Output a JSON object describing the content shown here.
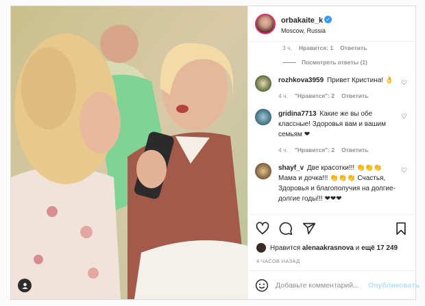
{
  "header": {
    "username": "orbakaite_k",
    "location": "Moscow, Russia"
  },
  "top_meta": {
    "time": "3 ч.",
    "likes": "Нравится: 1",
    "reply": "Ответить"
  },
  "view_replies": "Посмотреть ответы (1)",
  "comments": [
    {
      "user": "rozhkova3959",
      "text": "Привет Кристина! 👌",
      "time": "4 ч.",
      "likes": "\"Нравится\": 2",
      "reply": "Ответить"
    },
    {
      "user": "gridina7713",
      "text": "Какие же вы обе классные! Здоровья вам и вашим семьям ❤",
      "time": "4 ч.",
      "likes": "\"Нравится\": 2",
      "reply": "Ответить"
    },
    {
      "user": "shayf_v",
      "text": "Две красотки!!! 👏👏👏 Мама и дочка!!! 👏👏👏 Счастья, Здоровья и благополучия на долгие-долгие годы!!! ❤❤❤",
      "time": "",
      "likes": "",
      "reply": ""
    }
  ],
  "likes": {
    "prefix": "Нравится",
    "user": "alenaakrasnova",
    "mid": "и",
    "more": "ещё 17 249"
  },
  "timestamp": "4 ЧАСОВ НАЗАД",
  "add_comment": {
    "placeholder": "Добавьте комментарий...",
    "publish": "Опубликовать"
  },
  "colors": {
    "link": "#3897f0",
    "publish_disabled": "#b2dffc",
    "muted": "#8e8e8e"
  },
  "icons": [
    "verified-icon",
    "heart-icon",
    "comment-icon",
    "share-icon",
    "bookmark-icon",
    "emoji-icon",
    "tagged-user-icon"
  ]
}
